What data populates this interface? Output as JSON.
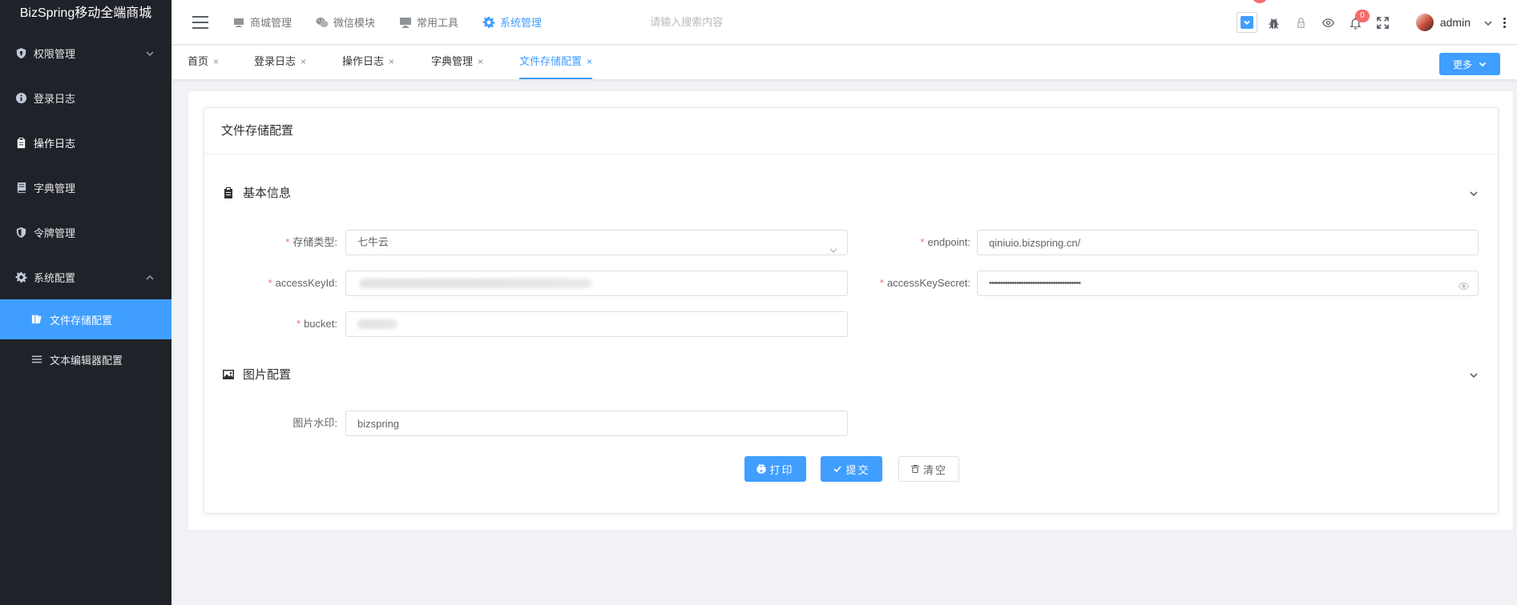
{
  "app": {
    "title": "BizSpring移动全端商城"
  },
  "sidebar": {
    "items": [
      {
        "label": "权限管理",
        "icon": "shield-icon",
        "has_arrow": true
      },
      {
        "label": "登录日志",
        "icon": "info-icon"
      },
      {
        "label": "操作日志",
        "icon": "clipboard-icon"
      },
      {
        "label": "字典管理",
        "icon": "book-icon"
      },
      {
        "label": "令牌管理",
        "icon": "badge-shield-icon"
      },
      {
        "label": "系统配置",
        "icon": "gear-icon",
        "expanded": true
      }
    ],
    "sub_items": [
      {
        "label": "文件存储配置",
        "icon": "files-icon",
        "active": true
      },
      {
        "label": "文本编辑器配置",
        "icon": "list-icon"
      }
    ]
  },
  "header": {
    "menu": [
      {
        "label": "商城管理",
        "icon": "monitor-icon"
      },
      {
        "label": "微信模块",
        "icon": "wechat-icon"
      },
      {
        "label": "常用工具",
        "icon": "desktop-icon"
      },
      {
        "label": "系统管理",
        "icon": "gear-icon",
        "active": true
      }
    ],
    "search_placeholder": "请输入搜索内容",
    "notification_count": "0",
    "username": "admin"
  },
  "tabs": {
    "items": [
      {
        "label": "首页",
        "close": "×"
      },
      {
        "label": "登录日志",
        "close": "×"
      },
      {
        "label": "操作日志",
        "close": "×"
      },
      {
        "label": "字典管理",
        "close": "×"
      },
      {
        "label": "文件存储配置",
        "close": "×",
        "active": true
      }
    ],
    "more_label": "更多"
  },
  "page": {
    "card_title": "文件存储配置",
    "section_basic": "基本信息",
    "section_image": "图片配置",
    "fields": {
      "storage_type": {
        "label": "存储类型:",
        "value": "七牛云",
        "required": true
      },
      "endpoint": {
        "label": "endpoint:",
        "value": "qiniuio.bizspring.cn/",
        "required": true
      },
      "access_key_id": {
        "label": "accessKeyId:",
        "value": "",
        "required": true
      },
      "access_key_secret": {
        "label": "accessKeySecret:",
        "value": "••••••••••••••••••••••••••••••••••••••••",
        "required": true
      },
      "bucket": {
        "label": "bucket:",
        "value": "",
        "required": true
      },
      "watermark": {
        "label": "图片水印:",
        "value": "bizspring",
        "required": false
      }
    },
    "buttons": {
      "print": "打印",
      "submit": "提交",
      "clear": "清空"
    },
    "required_mark": "*"
  },
  "colors": {
    "accent": "#409eff",
    "sidebar_bg": "#20222a",
    "danger": "#f56c6c"
  }
}
